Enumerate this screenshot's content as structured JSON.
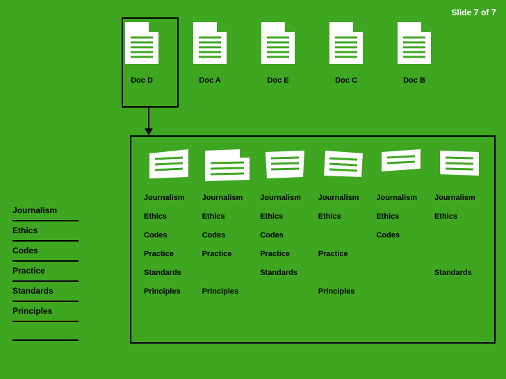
{
  "slide": {
    "prefix": "Slide",
    "current": "7",
    "of_word": "of",
    "total": "7"
  },
  "docs": [
    {
      "label": "Doc D"
    },
    {
      "label": "Doc A"
    },
    {
      "label": "Doc E"
    },
    {
      "label": "Doc C"
    },
    {
      "label": "Doc B"
    }
  ],
  "sidebar_terms": [
    "Journalism",
    "Ethics",
    "Codes",
    "Practice",
    "Standards",
    "Principles"
  ],
  "fragments": [
    [
      "Journalism",
      "Ethics",
      "Codes",
      "Practice",
      "Standards",
      "Principles"
    ],
    [
      "Journalism",
      "Ethics",
      "Codes",
      "Practice",
      "",
      "Principles"
    ],
    [
      "Journalism",
      "Ethics",
      "Codes",
      "Practice",
      "Standards",
      ""
    ],
    [
      "Journalism",
      "Ethics",
      "",
      "Practice",
      "",
      "Principles"
    ],
    [
      "Journalism",
      "Ethics",
      "Codes",
      "",
      "",
      ""
    ],
    [
      "Journalism",
      "Ethics",
      "",
      "",
      "Standards",
      ""
    ]
  ]
}
